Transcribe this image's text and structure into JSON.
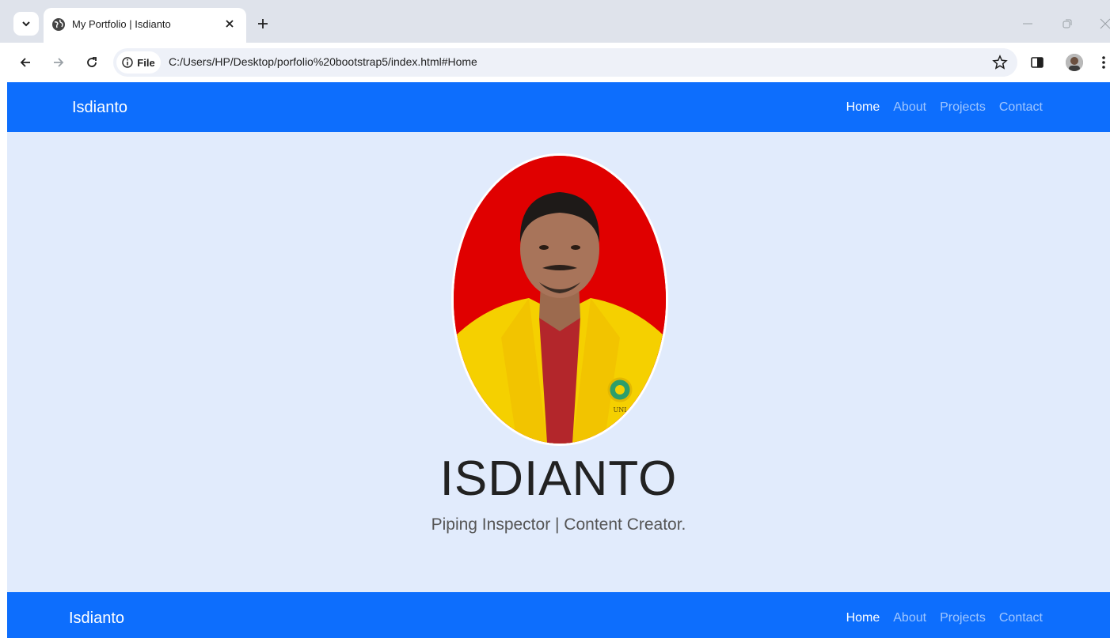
{
  "browser": {
    "tab_title": "My Portfolio | Isdianto",
    "address_chip": "File",
    "url": "C:/Users/HP/Desktop/porfolio%20bootstrap5/index.html#Home"
  },
  "navbar": {
    "brand": "Isdianto",
    "links": [
      "Home",
      "About",
      "Projects",
      "Contact"
    ],
    "active": "Home"
  },
  "hero": {
    "name": "ISDIANTO",
    "subtitle": "Piping Inspector | Content Creator.",
    "photo_badge_text": "UNI"
  },
  "footer": {
    "brand": "Isdianto",
    "links": [
      "Home",
      "About",
      "Projects",
      "Contact"
    ]
  },
  "colors": {
    "primary": "#0d6efd",
    "hero_background": "#e1ebfc",
    "photo_background": "#e00000",
    "jacket": "#f5d000"
  },
  "icons": [
    "chevron-down-icon",
    "globe-icon",
    "close-icon",
    "plus-icon",
    "minimize-icon",
    "restore-icon",
    "back-icon",
    "forward-icon",
    "reload-icon",
    "info-icon",
    "star-icon",
    "side-panel-icon",
    "profile-avatar",
    "more-icon"
  ]
}
